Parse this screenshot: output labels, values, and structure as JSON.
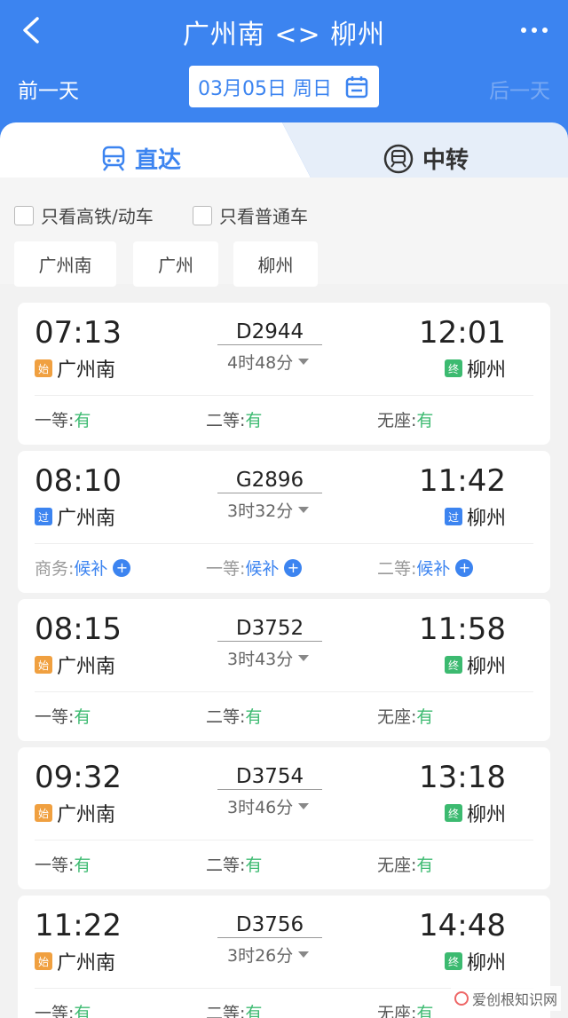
{
  "header": {
    "title": "广州南 <> 柳州",
    "prev_day": "前一天",
    "next_day": "后一天",
    "date": "03月05日 周日"
  },
  "tabs": {
    "direct": "直达",
    "transfer": "中转"
  },
  "filters": {
    "high_speed_only": "只看高铁/动车",
    "normal_only": "只看普通车"
  },
  "stations": [
    "广州南",
    "广州",
    "柳州"
  ],
  "trains": [
    {
      "dep_time": "07:13",
      "dep_station": "广州南",
      "dep_badge": "始",
      "train_no": "D2944",
      "duration": "4时48分",
      "arr_time": "12:01",
      "arr_station": "柳州",
      "arr_badge": "终",
      "seats": [
        {
          "class": "一等:",
          "status": "有"
        },
        {
          "class": "二等:",
          "status": "有"
        },
        {
          "class": "无座:",
          "status": "有"
        }
      ]
    },
    {
      "dep_time": "08:10",
      "dep_station": "广州南",
      "dep_badge": "过",
      "train_no": "G2896",
      "duration": "3时32分",
      "arr_time": "11:42",
      "arr_station": "柳州",
      "arr_badge": "过",
      "seats": [
        {
          "class": "商务:",
          "status": "候补"
        },
        {
          "class": "一等:",
          "status": "候补"
        },
        {
          "class": "二等:",
          "status": "候补"
        }
      ]
    },
    {
      "dep_time": "08:15",
      "dep_station": "广州南",
      "dep_badge": "始",
      "train_no": "D3752",
      "duration": "3时43分",
      "arr_time": "11:58",
      "arr_station": "柳州",
      "arr_badge": "终",
      "seats": [
        {
          "class": "一等:",
          "status": "有"
        },
        {
          "class": "二等:",
          "status": "有"
        },
        {
          "class": "无座:",
          "status": "有"
        }
      ]
    },
    {
      "dep_time": "09:32",
      "dep_station": "广州南",
      "dep_badge": "始",
      "train_no": "D3754",
      "duration": "3时46分",
      "arr_time": "13:18",
      "arr_station": "柳州",
      "arr_badge": "终",
      "seats": [
        {
          "class": "一等:",
          "status": "有"
        },
        {
          "class": "二等:",
          "status": "有"
        },
        {
          "class": "无座:",
          "status": "有"
        }
      ]
    },
    {
      "dep_time": "11:22",
      "dep_station": "广州南",
      "dep_badge": "始",
      "train_no": "D3756",
      "duration": "3时26分",
      "arr_time": "14:48",
      "arr_station": "柳州",
      "arr_badge": "终",
      "seats": [
        {
          "class": "一等:",
          "status": "有"
        },
        {
          "class": "二等:",
          "status": "有"
        },
        {
          "class": "无座:",
          "status": "有"
        }
      ]
    }
  ],
  "watermark": "爱创根知识网",
  "colors": {
    "primary": "#3c84f0",
    "available": "#3cba70",
    "start_badge": "#f0a040",
    "end_badge": "#3cba70"
  }
}
